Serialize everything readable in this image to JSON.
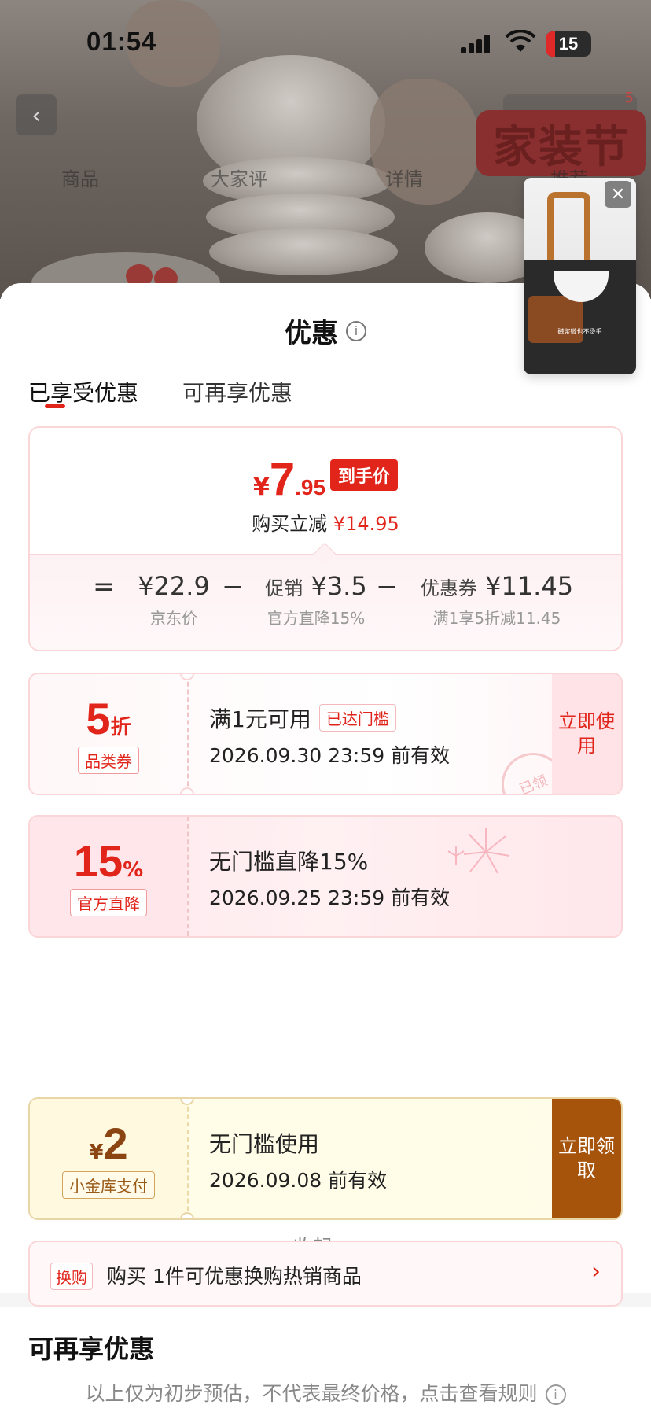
{
  "status": {
    "time": "01:54",
    "battery": "15"
  },
  "background": {
    "tabs": [
      "商品",
      "大家评",
      "详情",
      "推荐"
    ],
    "festival_badge": "家装节",
    "cart_count": "5"
  },
  "float_video": {
    "caption": "磁浆微也不烫手"
  },
  "sheet": {
    "title": "优惠",
    "tabs": [
      "已享受优惠",
      "可再享优惠"
    ],
    "summary": {
      "price_symbol": "¥",
      "price_int": "7",
      "price_dec": ".95",
      "price_tag": "到手价",
      "save_label": "购买立减",
      "save_value": "¥14.95",
      "equals": "=",
      "minus": "−",
      "items": [
        {
          "label": "",
          "value": "¥22.9",
          "sub": "京东价"
        },
        {
          "label": "促销",
          "value": "¥3.5",
          "sub": "官方直降15%"
        },
        {
          "label": "优惠券",
          "value": "¥11.45",
          "sub": "满1享5折减11.45"
        }
      ]
    },
    "coupons": [
      {
        "num": "5",
        "unit": "折",
        "chip": "品类券",
        "title": "满1元可用",
        "pill": "已达门槛",
        "date": "2026.09.30 23:59 前有效",
        "action": "立即使用",
        "stamp": "已领"
      },
      {
        "num": "15",
        "unit": "%",
        "chip": "官方直降",
        "title": "无门槛直降15%",
        "date": "2026.09.25 23:59 前有效"
      }
    ],
    "collapse_label": "收起",
    "more_title": "可再享优惠",
    "more_coupon": {
      "symbol": "¥",
      "num": "2",
      "chip": "小金库支付",
      "title": "无门槛使用",
      "date": "2026.09.08 前有效",
      "action": "立即领取"
    },
    "swap": {
      "tag": "换购",
      "text": "购买 1件可优惠换购热销商品"
    },
    "footnote": "以上仅为初步预估，不代表最终价格，点击查看规则"
  },
  "colors": {
    "accent": "#e1251b",
    "gold_action": "#a6530c"
  }
}
